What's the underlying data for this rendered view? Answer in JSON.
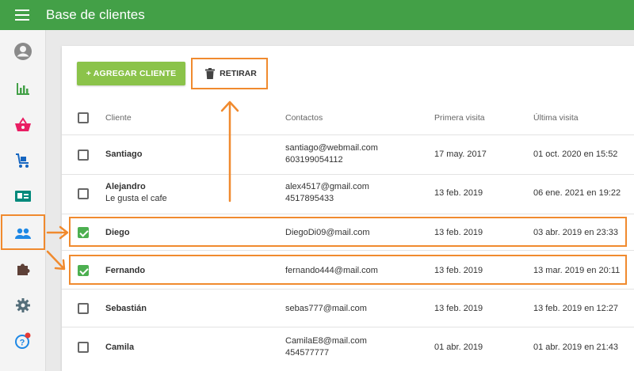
{
  "header": {
    "title": "Base de clientes"
  },
  "sidebar": {
    "items": [
      {
        "name": "account",
        "icon": "account-circle-icon"
      },
      {
        "name": "stats",
        "icon": "bar-chart-icon"
      },
      {
        "name": "sales",
        "icon": "basket-icon"
      },
      {
        "name": "delivery",
        "icon": "cart-icon"
      },
      {
        "name": "cards",
        "icon": "id-card-icon"
      },
      {
        "name": "clients",
        "icon": "people-icon",
        "active": true
      },
      {
        "name": "extensions",
        "icon": "puzzle-icon"
      },
      {
        "name": "settings",
        "icon": "gear-icon"
      },
      {
        "name": "help",
        "icon": "help-icon"
      }
    ]
  },
  "toolbar": {
    "add_label": "+ AGREGAR CLIENTE",
    "remove_label": "RETIRAR"
  },
  "table": {
    "headers": {
      "client": "Cliente",
      "contacts": "Contactos",
      "first_visit": "Primera visita",
      "last_visit": "Última visita"
    },
    "rows": [
      {
        "name": "Santiago",
        "note": "",
        "contact1": "santiago@webmail.com",
        "contact2": "603199054112",
        "first": "17 may. 2017",
        "last": "01 oct. 2020 en 15:52",
        "checked": false
      },
      {
        "name": "Alejandro",
        "note": "Le gusta el cafe",
        "contact1": "alex4517@gmail.com",
        "contact2": "4517895433",
        "first": "13 feb. 2019",
        "last": "06 ene. 2021 en 19:22",
        "checked": false
      },
      {
        "name": "Diego",
        "note": "",
        "contact1": "DiegoDi09@mail.com",
        "contact2": "",
        "first": "13 feb. 2019",
        "last": "03 abr. 2019 en 23:33",
        "checked": true
      },
      {
        "name": "Fernando",
        "note": "",
        "contact1": "fernando444@mail.com",
        "contact2": "",
        "first": "13 feb. 2019",
        "last": "13 mar. 2019 en 20:11",
        "checked": true
      },
      {
        "name": "Sebastián",
        "note": "",
        "contact1": "sebas777@mail.com",
        "contact2": "",
        "first": "13 feb. 2019",
        "last": "13 feb. 2019 en 12:27",
        "checked": false
      },
      {
        "name": "Camila",
        "note": "",
        "contact1": "CamilaE8@mail.com",
        "contact2": "454577777",
        "first": "01 abr. 2019",
        "last": "01 abr. 2019 en 21:43",
        "checked": false
      }
    ]
  },
  "colors": {
    "brand": "#43a047",
    "accent_button": "#8bc34a",
    "highlight": "#f08a2e",
    "checked": "#4caf50"
  }
}
